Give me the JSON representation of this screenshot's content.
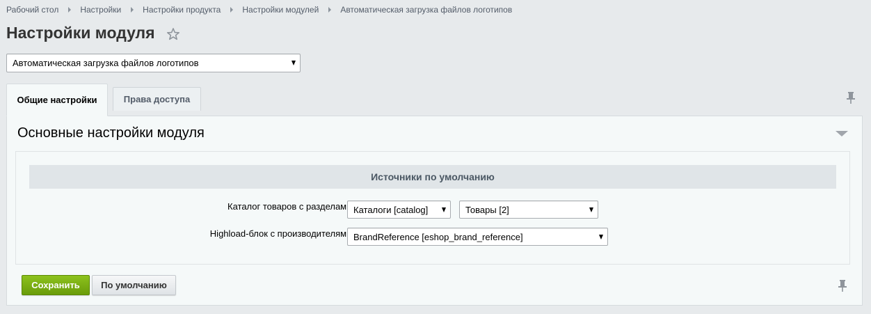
{
  "breadcrumb": [
    {
      "label": "Рабочий стол"
    },
    {
      "label": "Настройки"
    },
    {
      "label": "Настройки продукта"
    },
    {
      "label": "Настройки модулей"
    },
    {
      "label": "Автоматическая загрузка файлов логотипов"
    }
  ],
  "page": {
    "title": "Настройки модуля"
  },
  "module_select": {
    "value": "Автоматическая загрузка файлов логотипов"
  },
  "tabs": [
    {
      "label": "Общие настройки",
      "active": true
    },
    {
      "label": "Права доступа",
      "active": false
    }
  ],
  "section": {
    "title": "Основные настройки модуля",
    "subheading": "Источники по умолчанию"
  },
  "fields": {
    "catalog": {
      "label": "Каталог товаров с разделами:",
      "type_value": "Каталоги [catalog]",
      "iblock_value": "Товары [2]"
    },
    "highload": {
      "label": "Highload-блок с производителями:",
      "value": "BrandReference [eshop_brand_reference]"
    }
  },
  "buttons": {
    "save": "Сохранить",
    "default": "По умолчанию"
  },
  "icons": {
    "star": "star-icon",
    "pin": "pin-icon",
    "collapse": "chevron-down-icon"
  },
  "colors": {
    "save_button": "#79ad12",
    "background": "#e7eaec",
    "panel": "#f5f9f9"
  }
}
